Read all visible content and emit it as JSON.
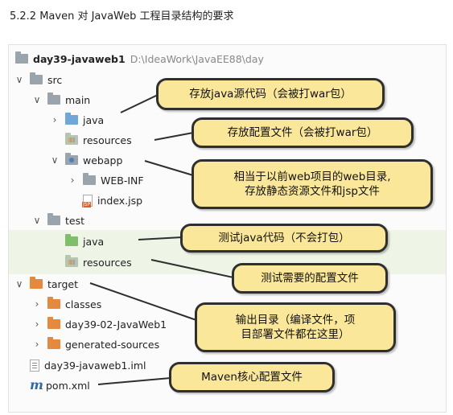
{
  "heading": "5.2.2 Maven 对 JavaWeb 工程目录结构的要求",
  "tree": {
    "root_name": "day39-javaweb1",
    "root_path": "D:\\IdeaWork\\JavaEE88\\day",
    "items": [
      {
        "label": "src",
        "icon": "folder-icon",
        "expanded": true
      },
      {
        "label": "main",
        "icon": "folder-icon",
        "expanded": true
      },
      {
        "label": "java",
        "icon": "source-folder-icon",
        "expanded": false
      },
      {
        "label": "resources",
        "icon": "resources-folder-icon"
      },
      {
        "label": "webapp",
        "icon": "web-folder-icon",
        "expanded": true
      },
      {
        "label": "WEB-INF",
        "icon": "folder-icon",
        "expanded": false
      },
      {
        "label": "index.jsp",
        "icon": "jsp-file-icon"
      },
      {
        "label": "test",
        "icon": "folder-icon",
        "expanded": true
      },
      {
        "label": "java",
        "icon": "test-source-folder-icon"
      },
      {
        "label": "resources",
        "icon": "test-resources-folder-icon"
      },
      {
        "label": "target",
        "icon": "excluded-folder-icon",
        "expanded": true
      },
      {
        "label": "classes",
        "icon": "excluded-folder-icon",
        "expanded": false
      },
      {
        "label": "day39-02-JavaWeb1",
        "icon": "excluded-folder-icon",
        "expanded": false
      },
      {
        "label": "generated-sources",
        "icon": "excluded-folder-icon",
        "expanded": false
      },
      {
        "label": "day39-javaweb1.iml",
        "icon": "iml-file-icon"
      },
      {
        "label": "pom.xml",
        "icon": "maven-icon"
      }
    ]
  },
  "callouts": {
    "main_java": "存放java源代码（会被打war包）",
    "main_resources": "存放配置文件（会被打war包）",
    "webapp_line1": "相当于以前web项目的web目录,",
    "webapp_line2": "存放静态资源文件和jsp文件",
    "test_java": "测试java代码（不会打包）",
    "test_resources": "测试需要的配置文件",
    "target_line1": "输出目录（编译文件，项",
    "target_line2": "目部署文件都在这里）",
    "pom": "Maven核心配置文件"
  },
  "colors": {
    "callout_fill": "#fbe79a",
    "callout_border": "#2f2f2f",
    "test_highlight": "#eef4e6",
    "target_folder": "#e5893f"
  }
}
